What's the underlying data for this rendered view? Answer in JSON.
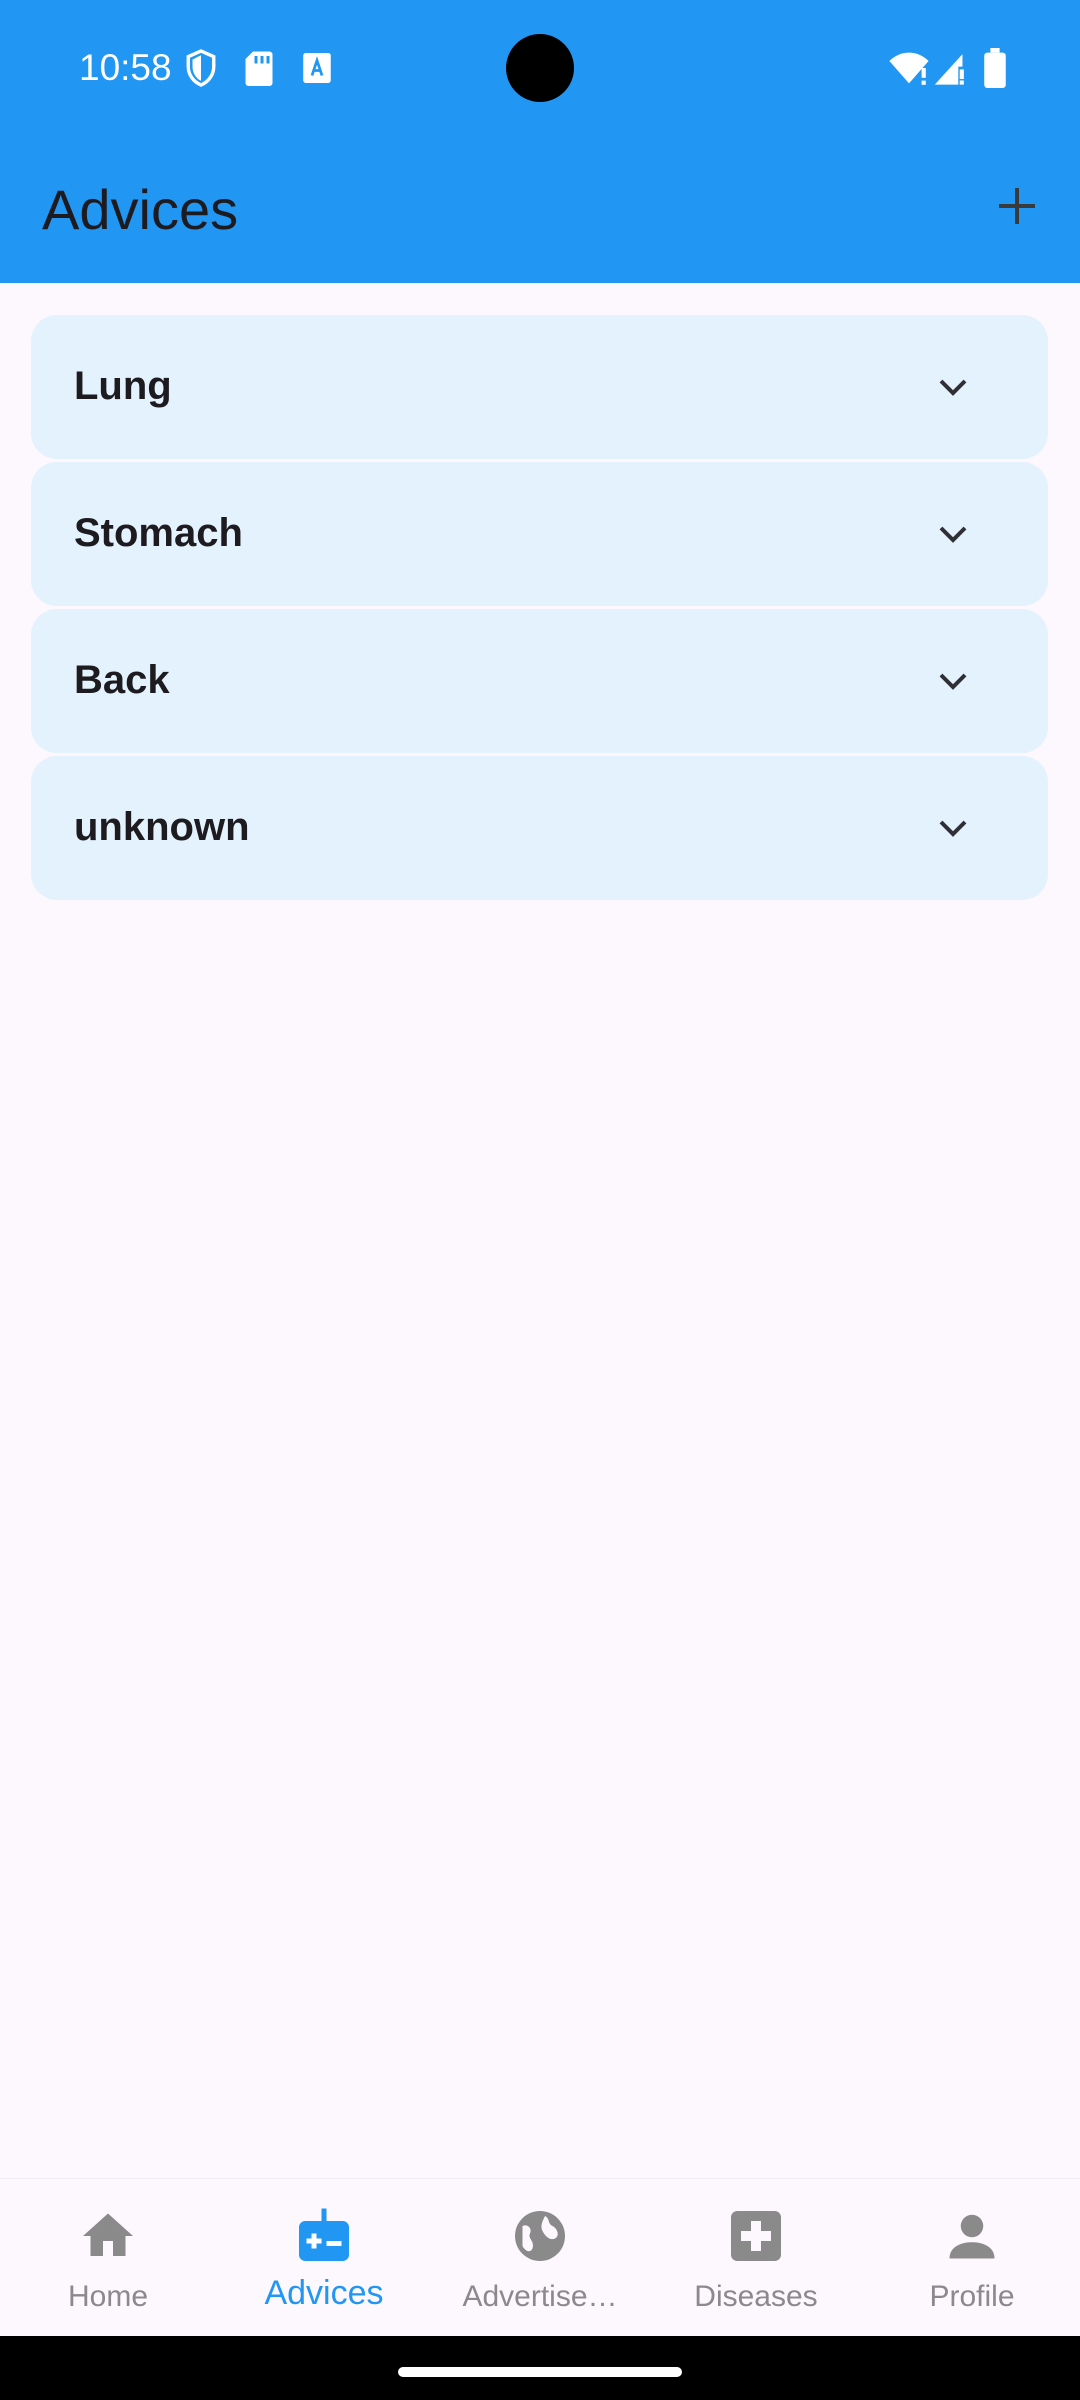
{
  "status_bar": {
    "time": "10:58"
  },
  "app_bar": {
    "title": "Advices"
  },
  "advices": [
    {
      "label": "Lung"
    },
    {
      "label": "Stomach"
    },
    {
      "label": "Back"
    },
    {
      "label": "unknown"
    }
  ],
  "bottom_nav": {
    "items": [
      {
        "label": "Home",
        "icon": "home-icon",
        "active": false
      },
      {
        "label": "Advices",
        "icon": "medical-bag-icon",
        "active": true
      },
      {
        "label": "Advertise…",
        "icon": "globe-icon",
        "active": false
      },
      {
        "label": "Diseases",
        "icon": "medical-cross-icon",
        "active": false
      },
      {
        "label": "Profile",
        "icon": "person-icon",
        "active": false
      }
    ]
  },
  "colors": {
    "primary": "#2196F3",
    "card_bg": "#E3F2FD",
    "page_bg": "#FDF7FE",
    "inactive": "#8a8a8a"
  }
}
